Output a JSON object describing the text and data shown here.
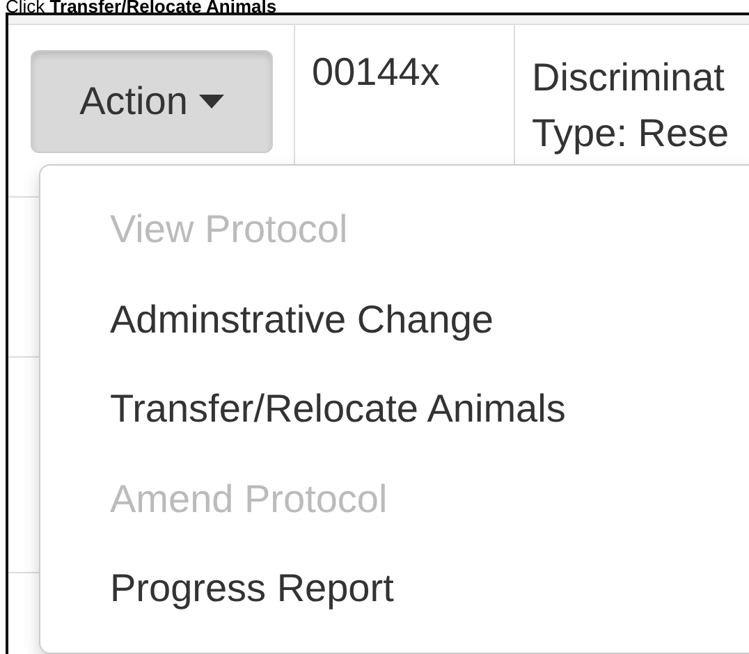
{
  "caption": "Click **Transfer/Relocate Animals**",
  "row": {
    "action_button": {
      "label": "Action",
      "expanded": true
    },
    "id": "00144x",
    "description_lines": [
      "Discriminat",
      "Type: Rese"
    ]
  },
  "menu": [
    {
      "label": "View Protocol",
      "disabled": true
    },
    {
      "label": "Adminstrative Change",
      "disabled": false
    },
    {
      "label": "Transfer/Relocate Animals",
      "disabled": false
    },
    {
      "label": "Amend Protocol",
      "disabled": true
    },
    {
      "label": "Progress Report",
      "disabled": false
    }
  ]
}
